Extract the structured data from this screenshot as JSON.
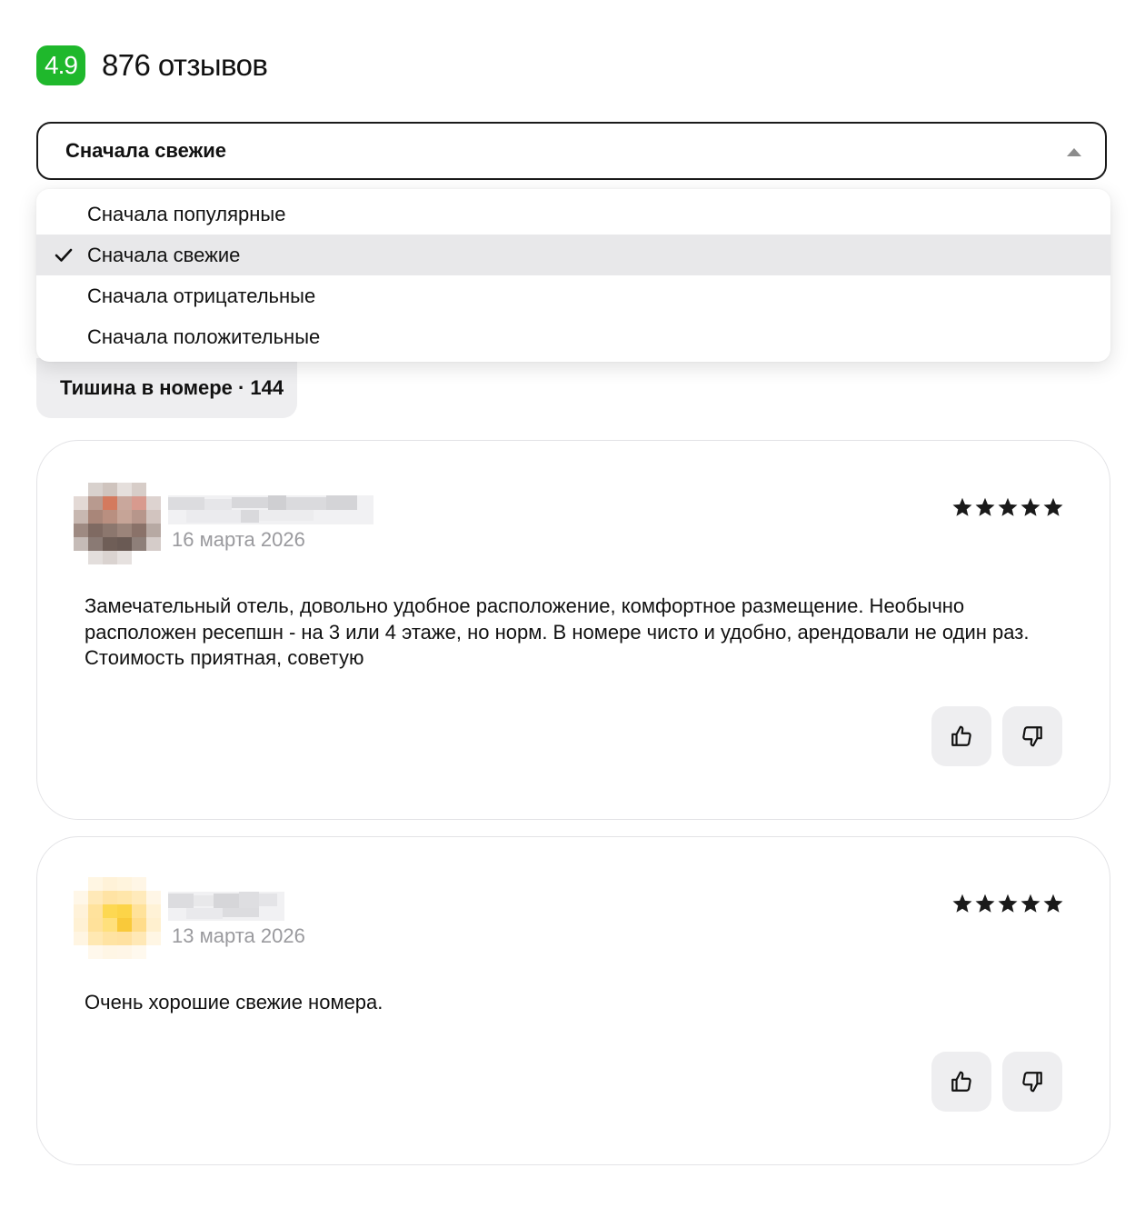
{
  "header": {
    "rating": "4.9",
    "reviews_count": "876 отзывов",
    "rating_color": "#1fb82c"
  },
  "sort": {
    "selected_label": "Сначала свежие",
    "options": [
      {
        "label": "Сначала популярные",
        "selected": false
      },
      {
        "label": "Сначала свежие",
        "selected": true
      },
      {
        "label": "Сначала отрицательные",
        "selected": false
      },
      {
        "label": "Сначала положительные",
        "selected": false
      }
    ]
  },
  "tag": {
    "label": "Тишина в номере · 144"
  },
  "reviews": [
    {
      "author": "",
      "author_blurred": true,
      "date": "16 марта 2026",
      "rating": 5,
      "text": "Замечательный отель, довольно удобное расположение, комфортное размещение. Необычно расположен ресепшн - на 3 или 4 этаже, но норм. В номере чисто и удобно, арендовали не один раз. Стоимость приятная, советую",
      "like_icon": "thumbs-up-icon",
      "dislike_icon": "thumbs-down-icon"
    },
    {
      "author": "",
      "author_blurred": true,
      "date": "13 марта 2026",
      "rating": 5,
      "text": "Очень хорошие свежие номера.",
      "like_icon": "thumbs-up-icon",
      "dislike_icon": "thumbs-down-icon"
    }
  ]
}
